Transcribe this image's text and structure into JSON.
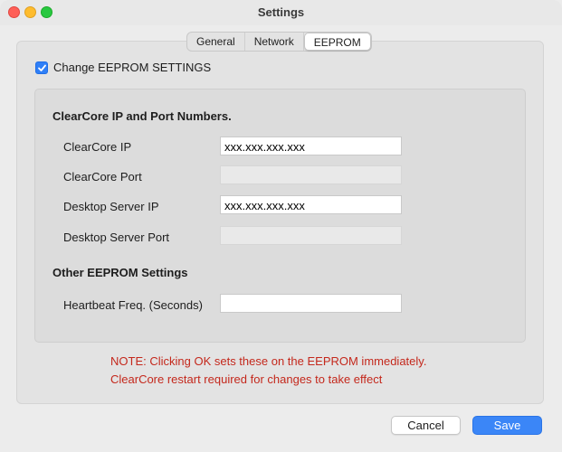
{
  "window": {
    "title": "Settings"
  },
  "tabs": [
    {
      "label": "General",
      "active": false
    },
    {
      "label": "Network",
      "active": false
    },
    {
      "label": "EEPROM",
      "active": true
    }
  ],
  "change_settings": {
    "label": "Change EEPROM SETTINGS",
    "checked": true
  },
  "sections": {
    "ip_ports": "ClearCore IP and Port Numbers.",
    "other": "Other EEPROM Settings"
  },
  "fields": {
    "clearcore_ip": {
      "label": "ClearCore IP",
      "value": "xxx.xxx.xxx.xxx"
    },
    "clearcore_port": {
      "label": "ClearCore Port",
      "value": ""
    },
    "desktop_ip": {
      "label": "Desktop Server IP",
      "value": "xxx.xxx.xxx.xxx"
    },
    "desktop_port": {
      "label": "Desktop Server Port",
      "value": ""
    },
    "heartbeat": {
      "label": "Heartbeat Freq. (Seconds)",
      "value": ""
    }
  },
  "note": {
    "line1": "NOTE: Clicking OK sets these on the EEPROM immediately.",
    "line2": "ClearCore restart required for changes to take effect"
  },
  "buttons": {
    "cancel": "Cancel",
    "save": "Save"
  },
  "colors": {
    "accent": "#3b86f7",
    "note_text": "#c4281c"
  }
}
